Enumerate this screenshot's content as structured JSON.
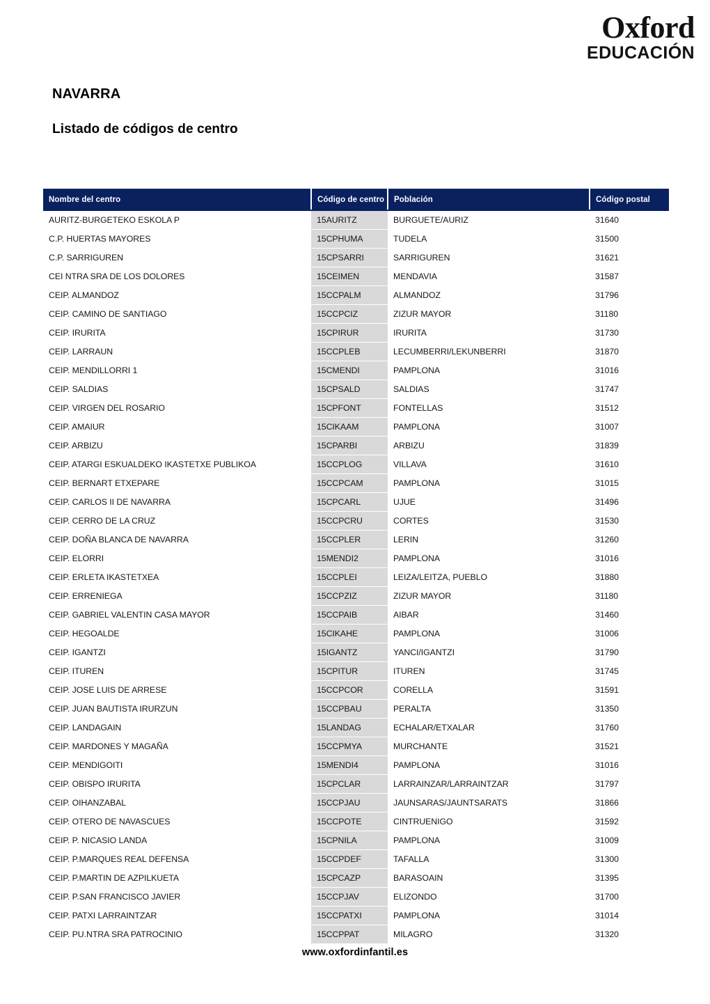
{
  "logo": {
    "brand": "Oxford",
    "tagline": "EDUCACIÓN"
  },
  "document": {
    "title": "NAVARRA",
    "subtitle": "Listado de códigos de centro"
  },
  "footer": {
    "url": "www.oxfordinfantil.es"
  },
  "colors": {
    "header_navy": "#0a2160",
    "code_column_gray": "#d9d9d9",
    "text": "#161616",
    "page_background": "#ffffff"
  },
  "table": {
    "columns": [
      "Nombre del centro",
      "Código de centro",
      "Población",
      "Código postal"
    ],
    "rows": [
      [
        "AURITZ-BURGETEKO ESKOLA P",
        "15AURITZ",
        "BURGUETE/AURIZ",
        "31640"
      ],
      [
        "C.P. HUERTAS MAYORES",
        "15CPHUMA",
        "TUDELA",
        "31500"
      ],
      [
        "C.P. SARRIGUREN",
        "15CPSARRI",
        "SARRIGUREN",
        "31621"
      ],
      [
        "CEI NTRA SRA DE LOS DOLORES",
        "15CEIMEN",
        "MENDAVIA",
        "31587"
      ],
      [
        "CEIP.  ALMANDOZ",
        "15CCPALM",
        "ALMANDOZ",
        "31796"
      ],
      [
        "CEIP.  CAMINO DE SANTIAGO",
        "15CCPCIZ",
        "ZIZUR MAYOR",
        "31180"
      ],
      [
        "CEIP.  IRURITA",
        "15CPIRUR",
        "IRURITA",
        "31730"
      ],
      [
        "CEIP.  LARRAUN",
        "15CCPLEB",
        "LECUMBERRI/LEKUNBERRI",
        "31870"
      ],
      [
        "CEIP.  MENDILLORRI 1",
        "15CMENDI",
        "PAMPLONA",
        "31016"
      ],
      [
        "CEIP.  SALDIAS",
        "15CPSALD",
        "SALDIAS",
        "31747"
      ],
      [
        "CEIP.  VIRGEN DEL ROSARIO",
        "15CPFONT",
        "FONTELLAS",
        "31512"
      ],
      [
        "CEIP. AMAIUR",
        "15CIKAAM",
        "PAMPLONA",
        "31007"
      ],
      [
        "CEIP. ARBIZU",
        "15CPARBI",
        "ARBIZU",
        "31839"
      ],
      [
        "CEIP. ATARGI ESKUALDEKO IKASTETXE PUBLIKOA",
        "15CCPLOG",
        "VILLAVA",
        "31610"
      ],
      [
        "CEIP. BERNART ETXEPARE",
        "15CCPCAM",
        "PAMPLONA",
        "31015"
      ],
      [
        "CEIP. CARLOS II DE NAVARRA",
        "15CPCARL",
        "UJUE",
        "31496"
      ],
      [
        "CEIP. CERRO DE LA CRUZ",
        "15CCPCRU",
        "CORTES",
        "31530"
      ],
      [
        "CEIP. DOÑA BLANCA DE NAVARRA",
        "15CCPLER",
        "LERIN",
        "31260"
      ],
      [
        "CEIP. ELORRI",
        "15MENDI2",
        "PAMPLONA",
        "31016"
      ],
      [
        "CEIP. ERLETA IKASTETXEA",
        "15CCPLEI",
        "LEIZA/LEITZA, PUEBLO",
        "31880"
      ],
      [
        "CEIP. ERRENIEGA",
        "15CCPZIZ",
        "ZIZUR MAYOR",
        "31180"
      ],
      [
        "CEIP. GABRIEL VALENTIN CASA MAYOR",
        "15CCPAIB",
        "AIBAR",
        "31460"
      ],
      [
        "CEIP. HEGOALDE",
        "15CIKAHE",
        "PAMPLONA",
        "31006"
      ],
      [
        "CEIP. IGANTZI",
        "15IGANTZ",
        "YANCI/IGANTZI",
        "31790"
      ],
      [
        "CEIP. ITUREN",
        "15CPITUR",
        "ITUREN",
        "31745"
      ],
      [
        "CEIP. JOSE LUIS DE ARRESE",
        "15CCPCOR",
        "CORELLA",
        "31591"
      ],
      [
        "CEIP. JUAN BAUTISTA IRURZUN",
        "15CCPBAU",
        "PERALTA",
        "31350"
      ],
      [
        "CEIP. LANDAGAIN",
        "15LANDAG",
        "ECHALAR/ETXALAR",
        "31760"
      ],
      [
        "CEIP. MARDONES Y MAGAÑA",
        "15CCPMYA",
        "MURCHANTE",
        "31521"
      ],
      [
        "CEIP. MENDIGOITI",
        "15MENDI4",
        "PAMPLONA",
        "31016"
      ],
      [
        "CEIP. OBISPO IRURITA",
        "15CPCLAR",
        "LARRAINZAR/LARRAINTZAR",
        "31797"
      ],
      [
        "CEIP. OIHANZABAL",
        "15CCPJAU",
        "JAUNSARAS/JAUNTSARATS",
        "31866"
      ],
      [
        "CEIP. OTERO DE NAVASCUES",
        "15CCPOTE",
        "CINTRUENIGO",
        "31592"
      ],
      [
        "CEIP. P. NICASIO LANDA",
        "15CPNILA",
        "PAMPLONA",
        "31009"
      ],
      [
        "CEIP. P.MARQUES REAL DEFENSA",
        "15CCPDEF",
        "TAFALLA",
        "31300"
      ],
      [
        "CEIP. P.MARTIN DE AZPILKUETA",
        "15CPCAZP",
        "BARASOAIN",
        "31395"
      ],
      [
        "CEIP. P.SAN FRANCISCO JAVIER",
        "15CCPJAV",
        "ELIZONDO",
        "31700"
      ],
      [
        "CEIP. PATXI LARRAINTZAR",
        "15CCPATXI",
        "PAMPLONA",
        "31014"
      ],
      [
        "CEIP. PU.NTRA SRA PATROCINIO",
        "15CCPPAT",
        "MILAGRO",
        "31320"
      ]
    ]
  }
}
